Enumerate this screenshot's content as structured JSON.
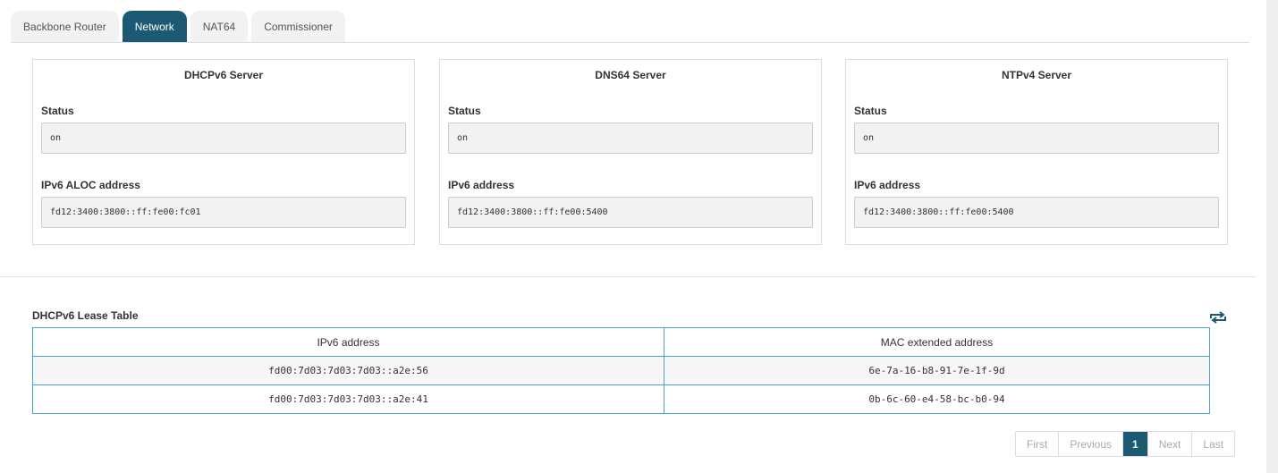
{
  "tabs": [
    {
      "label": "Backbone Router"
    },
    {
      "label": "Network"
    },
    {
      "label": "NAT64"
    },
    {
      "label": "Commissioner"
    }
  ],
  "active_tab": "Network",
  "cards": [
    {
      "title": "DHCPv6 Server",
      "status_label": "Status",
      "status_value": "on",
      "address_label": "IPv6 ALOC address",
      "address_value": "fd12:3400:3800::ff:fe00:fc01"
    },
    {
      "title": "DNS64 Server",
      "status_label": "Status",
      "status_value": "on",
      "address_label": "IPv6 address",
      "address_value": "fd12:3400:3800::ff:fe00:5400"
    },
    {
      "title": "NTPv4 Server",
      "status_label": "Status",
      "status_value": "on",
      "address_label": "IPv6 address",
      "address_value": "fd12:3400:3800::ff:fe00:5400"
    }
  ],
  "lease_table": {
    "title": "DHCPv6 Lease Table",
    "refresh_icon": "refresh-icon",
    "columns": [
      "IPv6 address",
      "MAC extended address"
    ],
    "rows": [
      [
        "fd00:7d03:7d03:7d03::a2e:56",
        "6e-7a-16-b8-91-7e-1f-9d"
      ],
      [
        "fd00:7d03:7d03:7d03::a2e:41",
        "0b-6c-60-e4-58-bc-b0-94"
      ]
    ]
  },
  "pagination": {
    "first": "First",
    "previous": "Previous",
    "current": "1",
    "next": "Next",
    "last": "Last"
  },
  "colors": {
    "accent": "#1b5a72",
    "table_border": "#4aa3c7"
  }
}
